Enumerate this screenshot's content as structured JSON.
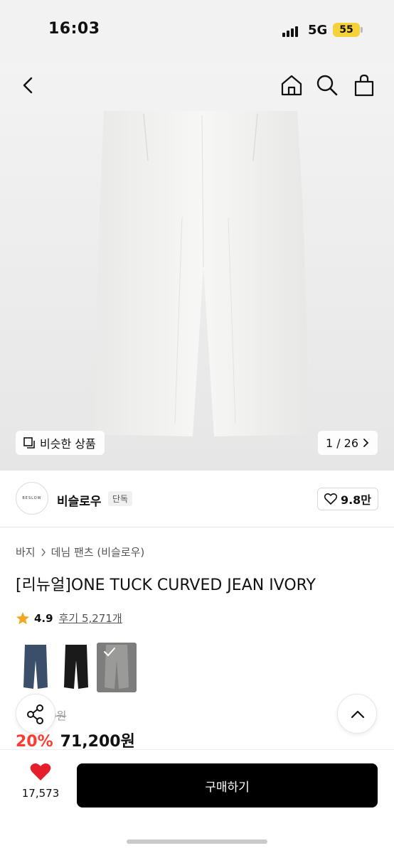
{
  "status": {
    "time": "16:03",
    "network": "5G",
    "battery": "55"
  },
  "header": {
    "back_icon": "chevron-left-icon",
    "home_icon": "home-icon",
    "search_icon": "search-icon",
    "bag_icon": "shopping-bag-icon"
  },
  "gallery": {
    "similar_label": "비슷한 상품",
    "counter": "1 / 26"
  },
  "brand": {
    "logo_text": "BESLOW",
    "name": "비슬로우",
    "badge": "단독",
    "likes": "9.8만"
  },
  "breadcrumb": {
    "category": "바지",
    "subcategory": "데님 팬츠 (비슬로우)"
  },
  "product": {
    "title": "[리뉴얼]ONE TUCK CURVED JEAN IVORY",
    "rating": "4.9",
    "reviews": "후기 5,271개",
    "swatches": [
      {
        "name": "navy",
        "color": "#3b4f6b"
      },
      {
        "name": "black",
        "color": "#1a1a1a"
      },
      {
        "name": "ivory",
        "color": "#e8e6e0",
        "selected": true
      }
    ],
    "original_price": "9원",
    "discount": "20%",
    "price": "71,200원"
  },
  "bottom": {
    "wish_count": "17,573",
    "buy_label": "구매하기"
  },
  "colors": {
    "accent_red": "#ff3b30",
    "heart_red": "#e61e2b",
    "star": "#f5a623",
    "battery": "#f6d23a"
  }
}
